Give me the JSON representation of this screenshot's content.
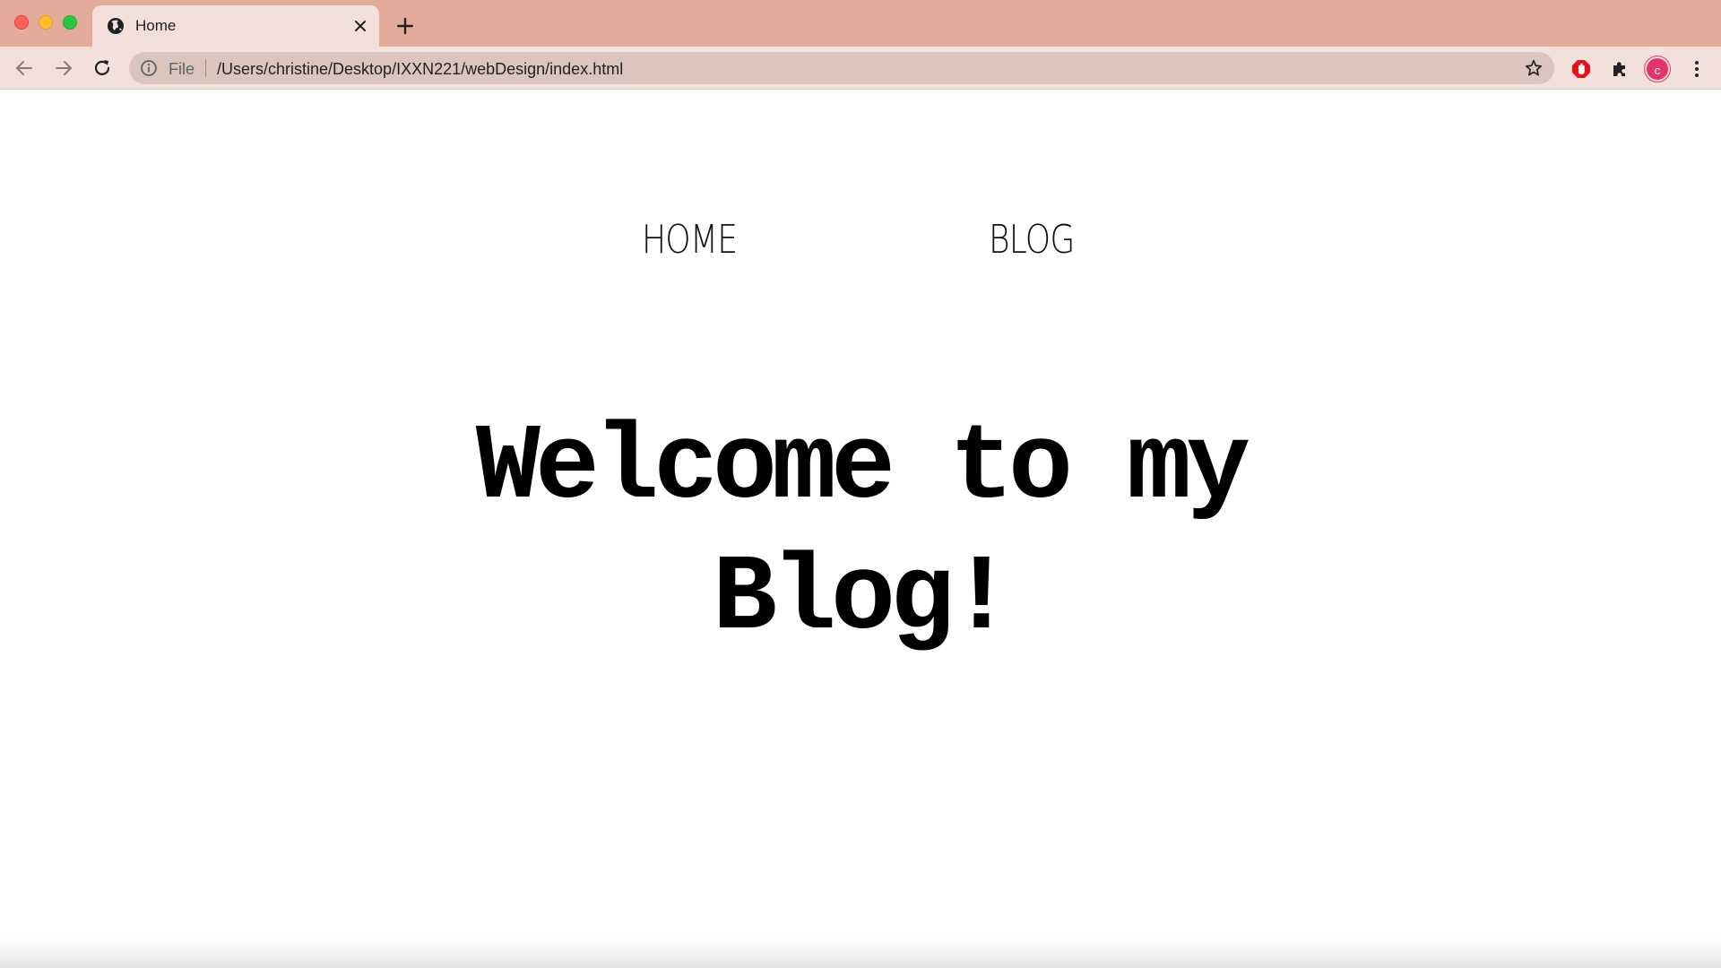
{
  "browser": {
    "tab": {
      "title": "Home",
      "favicon": "globe-icon"
    },
    "address_bar": {
      "scheme_label": "File",
      "url": "/Users/christine/Desktop/IXXN221/webDesign/index.html"
    },
    "profile_initial": "c",
    "colors": {
      "tabstrip": "#e2ab9b",
      "toolbar": "#f4e0da",
      "omnibox": "#dcc5bd",
      "avatar": "#e3336b",
      "adblock": "#e3141c"
    }
  },
  "site": {
    "nav": [
      "HOME",
      "BLOG"
    ],
    "heading": "Welcome to my Blog!"
  }
}
